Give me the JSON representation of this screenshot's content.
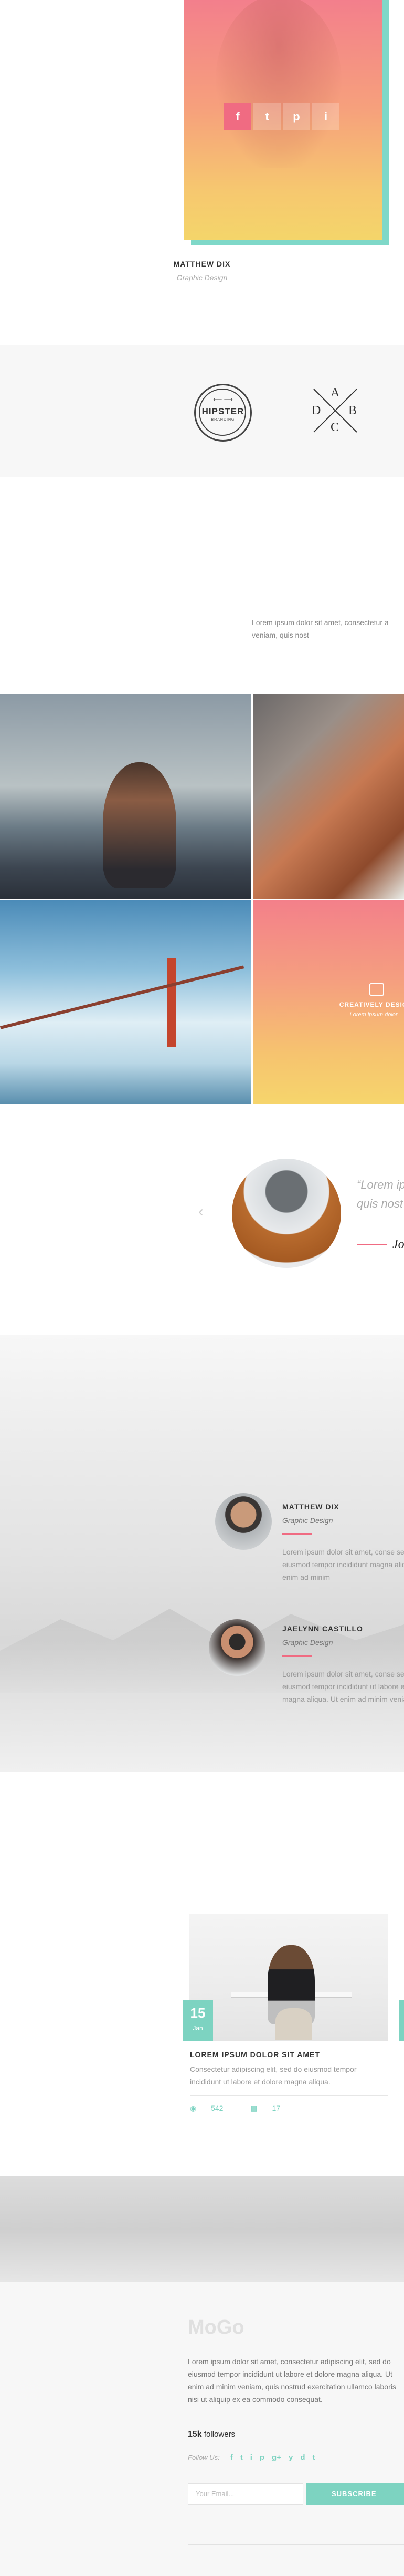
{
  "team_card": {
    "name": "MATTHEW DIX",
    "role": "Graphic Design",
    "social": [
      "f",
      "t",
      "p",
      "i"
    ]
  },
  "logos": {
    "hipster": {
      "title": "HIPSTER",
      "sub": "BRANDING"
    },
    "abcd": [
      "A",
      "D",
      "B",
      "C"
    ]
  },
  "intro": {
    "text": "Lorem ipsum dolor sit amet, consectetur a veniam, quis nost"
  },
  "gallery": {
    "caption": "CREATIVELY DESIG",
    "subcaption": "Lorem ipsum dolor"
  },
  "testimonial": {
    "quote": "“Lorem ip tempor in quis nost",
    "name": "Jo"
  },
  "team_list": [
    {
      "name": "MATTHEW DIX",
      "role": "Graphic Design",
      "text": "Lorem ipsum dolor sit amet, conse sed do eiusmod tempor incididunt magna aliqua. Ut enim ad minim"
    },
    {
      "name": "JAELYNN CASTILLO",
      "role": "Graphic Design",
      "text": "Lorem ipsum dolor sit amet, conse sed do eiusmod tempor incididunt ut labore et dolore magna aliqua. Ut enim ad minim veniam"
    }
  ],
  "blog": {
    "day": "15",
    "month": "Jan",
    "title": "LOREM IPSUM DOLOR SIT AMET",
    "text": "Consectetur adipiscing elit, sed do eiusmod tempor incididunt ut labore et dolore magna aliqua.",
    "views": "542",
    "comments": "17"
  },
  "footer": {
    "logo": "MoGo",
    "text": "Lorem ipsum dolor sit amet, consectetur adipiscing elit, sed do eiusmod tempor incididunt ut labore et dolore magna aliqua. Ut enim ad minim veniam, quis nostrud exercitation ullamco laboris nisi ut aliquip ex ea commodo consequat.",
    "followers_count": "15k",
    "followers_label": "followers",
    "follow_label": "Follow Us:",
    "social": [
      "f",
      "t",
      "i",
      "p",
      "g+",
      "y",
      "d",
      "t"
    ],
    "email_placeholder": "Your Email...",
    "subscribe_label": "SUBSCRIBE"
  },
  "colors": {
    "accent_pink": "#f06b82",
    "accent_teal": "#7dd3c1",
    "gradient_top": "#f37f8c",
    "gradient_bottom": "#f4d56a"
  }
}
